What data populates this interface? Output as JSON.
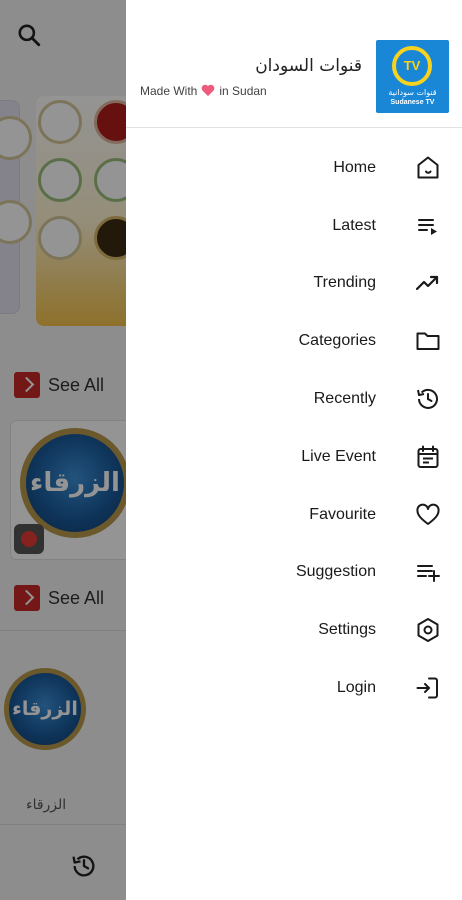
{
  "background": {
    "see_all_1": "See All",
    "see_all_2": "See All",
    "big_logo_text": "الزرقاء",
    "card_caption": "الزرقاء"
  },
  "drawer": {
    "app_title": "قنوات السودان",
    "made_with_prefix": "Made With",
    "made_with_suffix": "in Sudan",
    "logo_badge": "TV",
    "logo_caption_ar": "قنوات سودانية",
    "logo_caption_en": "Sudanese TV",
    "menu": [
      {
        "label": "Home",
        "icon": "home-icon"
      },
      {
        "label": "Latest",
        "icon": "playlist-icon"
      },
      {
        "label": "Trending",
        "icon": "trending-up-icon"
      },
      {
        "label": "Categories",
        "icon": "folder-icon"
      },
      {
        "label": "Recently",
        "icon": "history-icon"
      },
      {
        "label": "Live Event",
        "icon": "calendar-icon"
      },
      {
        "label": "Favourite",
        "icon": "heart-icon"
      },
      {
        "label": "Suggestion",
        "icon": "playlist-add-icon"
      },
      {
        "label": "Settings",
        "icon": "settings-icon"
      },
      {
        "label": "Login",
        "icon": "login-icon"
      }
    ]
  },
  "colors": {
    "accent_red": "#c62828",
    "logo_blue": "#1a86d6",
    "logo_yellow": "#f7d21f",
    "heart_pink": "#ef5b7a"
  }
}
